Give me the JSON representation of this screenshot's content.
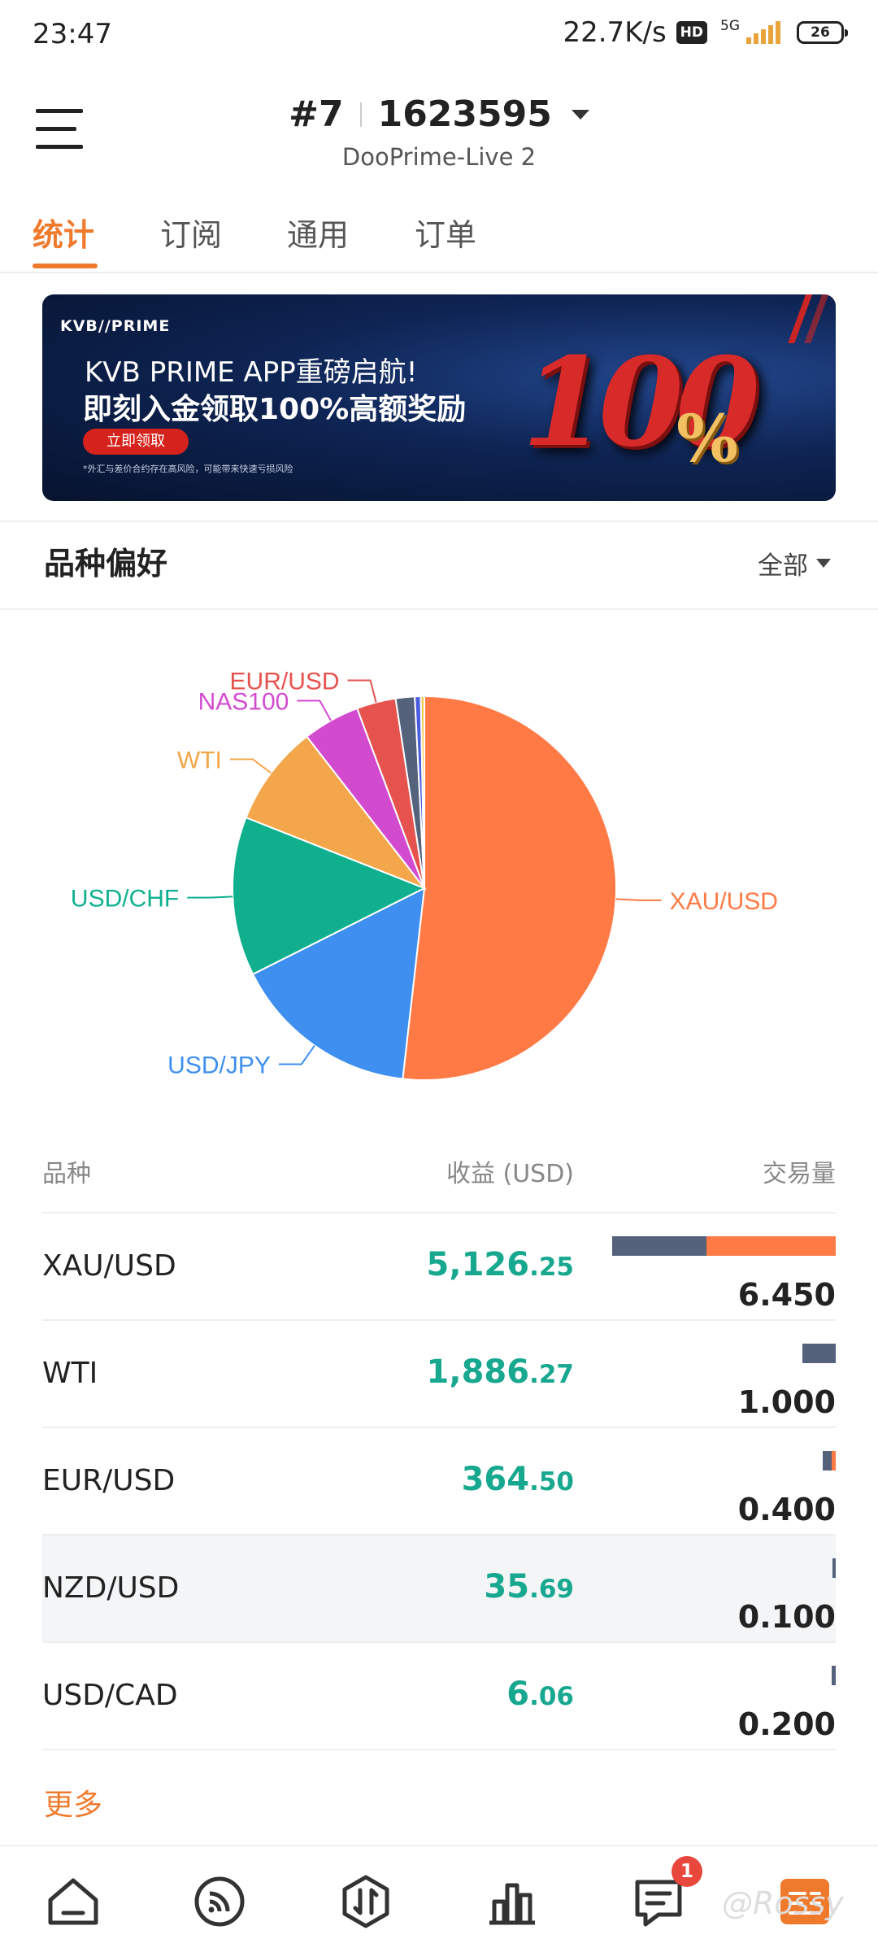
{
  "status_bar": {
    "time": "23:47",
    "net_speed": "22.7K/s",
    "hd_badge": "HD",
    "network": "5G",
    "battery": "26"
  },
  "header": {
    "account_number_prefix": "#7",
    "account_number": "1623595",
    "server": "DooPrime-Live 2"
  },
  "tabs": [
    {
      "label": "统计",
      "active": true
    },
    {
      "label": "订阅",
      "active": false
    },
    {
      "label": "通用",
      "active": false
    },
    {
      "label": "订单",
      "active": false
    }
  ],
  "banner": {
    "brand": "KVB//PRIME",
    "line1": "KVB PRIME APP重磅启航!",
    "line2": "即刻入金领取100%高额奖励",
    "cta": "立即领取",
    "disclaimer": "*外汇与差价合约存在高风险，可能带来快速亏损风险",
    "big_number": "100",
    "percent": "%"
  },
  "section": {
    "title": "品种偏好",
    "filter": "全部"
  },
  "chart_data": {
    "type": "pie",
    "slices": [
      {
        "label": "XAU/USD",
        "value": 51.8,
        "color": "#ff7a45"
      },
      {
        "label": "USD/JPY",
        "value": 15.8,
        "color": "#3e8ff0"
      },
      {
        "label": "USD/CHF",
        "value": 13.4,
        "color": "#10b08f"
      },
      {
        "label": "WTI",
        "value": 8.5,
        "color": "#f3a64a"
      },
      {
        "label": "NAS100",
        "value": 4.8,
        "color": "#d24bcf"
      },
      {
        "label": "EUR/USD",
        "value": 3.3,
        "color": "#e6534f"
      },
      {
        "label": "",
        "value": 1.6,
        "color": "#54627c"
      },
      {
        "label": "",
        "value": 0.5,
        "color": "#4a5de0"
      },
      {
        "label": "",
        "value": 0.3,
        "color": "#f3c64a"
      }
    ]
  },
  "table": {
    "headers": {
      "symbol": "品种",
      "profit": "收益 (USD)",
      "volume": "交易量"
    },
    "rows": [
      {
        "symbol": "XAU/USD",
        "profit_int": "5,126",
        "profit_dec": ".25",
        "volume": "6.450",
        "bar_buy": 0.42,
        "bar_sell": 0.58
      },
      {
        "symbol": "WTI",
        "profit_int": "1,886",
        "profit_dec": ".27",
        "volume": "1.000",
        "bar_buy": 0.15,
        "bar_sell": 0.0
      },
      {
        "symbol": "EUR/USD",
        "profit_int": "364",
        "profit_dec": ".50",
        "volume": "0.400",
        "bar_buy": 0.04,
        "bar_sell": 0.02
      },
      {
        "symbol": "NZD/USD",
        "profit_int": "35",
        "profit_dec": ".69",
        "volume": "0.100",
        "bar_buy": 0.015,
        "bar_sell": 0.0
      },
      {
        "symbol": "USD/CAD",
        "profit_int": "6",
        "profit_dec": ".06",
        "volume": "0.200",
        "bar_buy": 0.02,
        "bar_sell": 0.0
      }
    ],
    "more": "更多"
  },
  "bottom_nav": {
    "items": [
      "home-icon",
      "feed-icon",
      "trade-icon",
      "chart-icon",
      "message-icon",
      "profile-icon"
    ],
    "message_badge": "1"
  },
  "watermark": "@Rossy",
  "colors": {
    "accent": "#f07a2c",
    "profit": "#17a88f",
    "bar_buy": "#54627c",
    "bar_sell": "#ff7a45"
  }
}
